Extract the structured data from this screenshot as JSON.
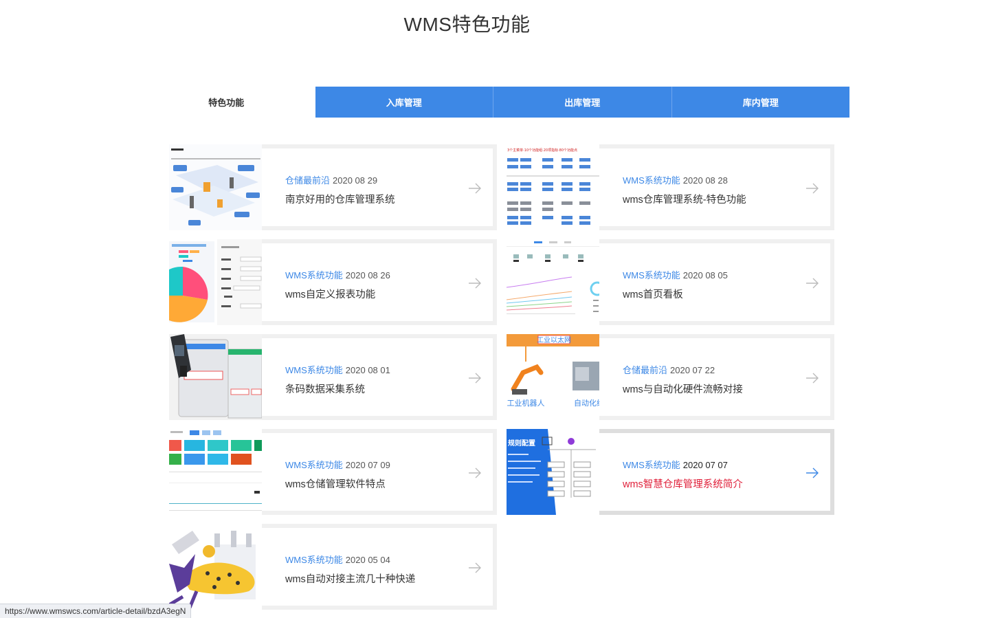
{
  "page": {
    "title": "WMS特色功能"
  },
  "tabs": [
    {
      "label": "特色功能",
      "active": true
    },
    {
      "label": "入库管理",
      "active": false
    },
    {
      "label": "出库管理",
      "active": false
    },
    {
      "label": "库内管理",
      "active": false
    }
  ],
  "articles": [
    {
      "category": "仓储最前沿",
      "date": "2020 08 29",
      "title": "南京好用的仓库管理系统"
    },
    {
      "category": "WMS系统功能",
      "date": "2020 08 28",
      "title": "wms仓库管理系统-特色功能"
    },
    {
      "category": "WMS系统功能",
      "date": "2020 08 26",
      "title": "wms自定义报表功能"
    },
    {
      "category": "WMS系统功能",
      "date": "2020 08 05",
      "title": "wms首页看板"
    },
    {
      "category": "WMS系统功能",
      "date": "2020 08 01",
      "title": "条码数据采集系统"
    },
    {
      "category": "仓储最前沿",
      "date": "2020 07 22",
      "title": "wms与自动化硬件流畅对接"
    },
    {
      "category": "WMS系统功能",
      "date": "2020 07 09",
      "title": "wms仓储管理软件特点"
    },
    {
      "category": "WMS系统功能",
      "date": "2020 07 07",
      "title": "wms智慧仓库管理系统简介"
    },
    {
      "category": "WMS系统功能",
      "date": "2020 05 04",
      "title": "wms自动对接主流几十种快递"
    }
  ],
  "thumb_text": {
    "t2_top": "3个主菜单·10个功能组·20项指标·80个功能点",
    "t6_banner": "工业以太网",
    "t6_robot": "工业机器人",
    "t6_auto": "自动化线",
    "t8_head": "规则配置"
  },
  "status_bar": {
    "url": "https://www.wmswcs.com/article-detail/bzdA3egN"
  },
  "colors": {
    "accent": "#3d88e6",
    "hover_title": "#e0203a"
  }
}
